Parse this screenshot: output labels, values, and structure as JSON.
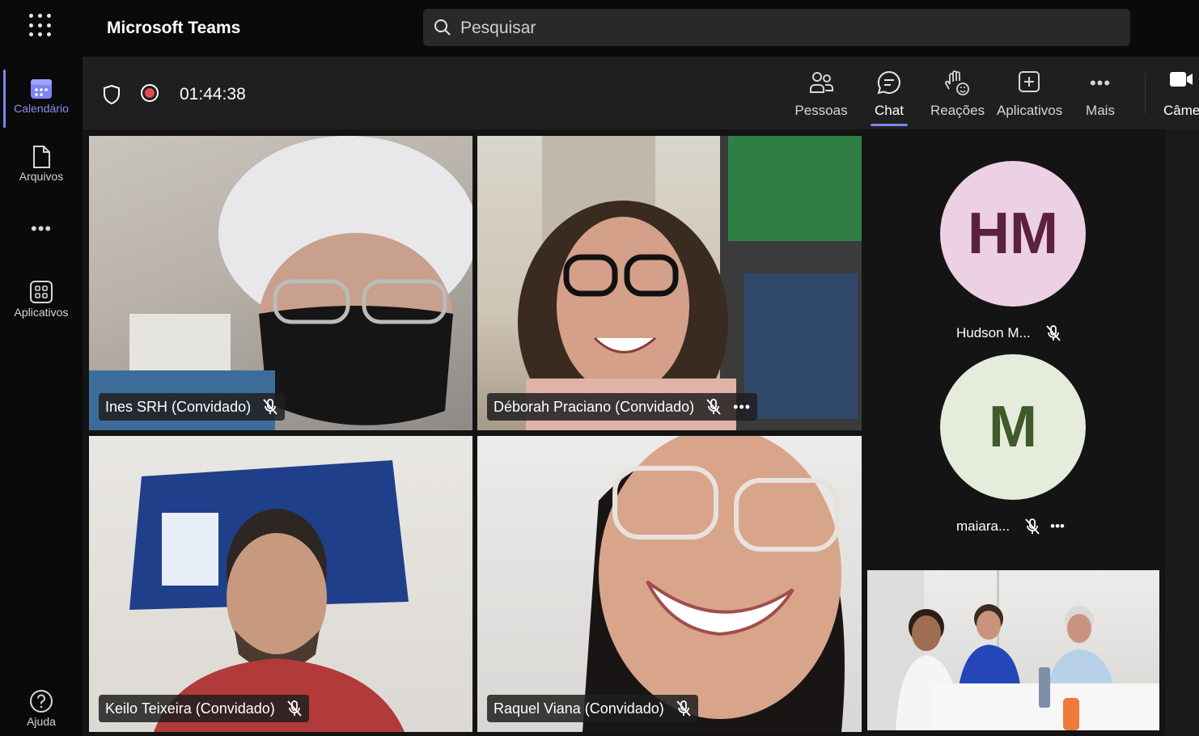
{
  "app": {
    "title": "Microsoft Teams"
  },
  "search": {
    "placeholder": "Pesquisar"
  },
  "rail": {
    "items": [
      {
        "label": "Calendário",
        "icon": "calendar-icon",
        "active": true
      },
      {
        "label": "Arquivos",
        "icon": "file-icon"
      },
      {
        "label": "Aplicativos",
        "icon": "apps-icon"
      },
      {
        "label": "Ajuda",
        "icon": "help-icon"
      }
    ],
    "more": "•••"
  },
  "meeting": {
    "timer": "01:44:38",
    "toolbar": [
      {
        "label": "Pessoas",
        "icon": "people-icon"
      },
      {
        "label": "Chat",
        "icon": "chat-icon",
        "active": true
      },
      {
        "label": "Reações",
        "icon": "reactions-icon"
      },
      {
        "label": "Aplicativos",
        "icon": "apps-add-icon"
      },
      {
        "label": "Mais",
        "icon": "more-icon"
      },
      {
        "label": "Câme",
        "icon": "camera-icon"
      }
    ],
    "more_glyph": "•••"
  },
  "participants": {
    "tiles": [
      {
        "name": "Ines SRH (Convidado)"
      },
      {
        "name": "Déborah Praciano (Convidado)",
        "has_more": true
      },
      {
        "name": "Keilo Teixeira (Convidado)"
      },
      {
        "name": "Raquel Viana (Convidado)"
      }
    ],
    "side": [
      {
        "initials": "HM",
        "name": "Hudson M...",
        "avatar_bg": "#ecd0e3",
        "avatar_fg": "#5b2142"
      },
      {
        "initials": "M",
        "name": "maiara...",
        "avatar_bg": "#e6ecdc",
        "avatar_fg": "#3e5b2a",
        "has_more": true
      }
    ]
  },
  "colors": {
    "accent": "#7f85f5",
    "recording": "#e14c4c"
  }
}
